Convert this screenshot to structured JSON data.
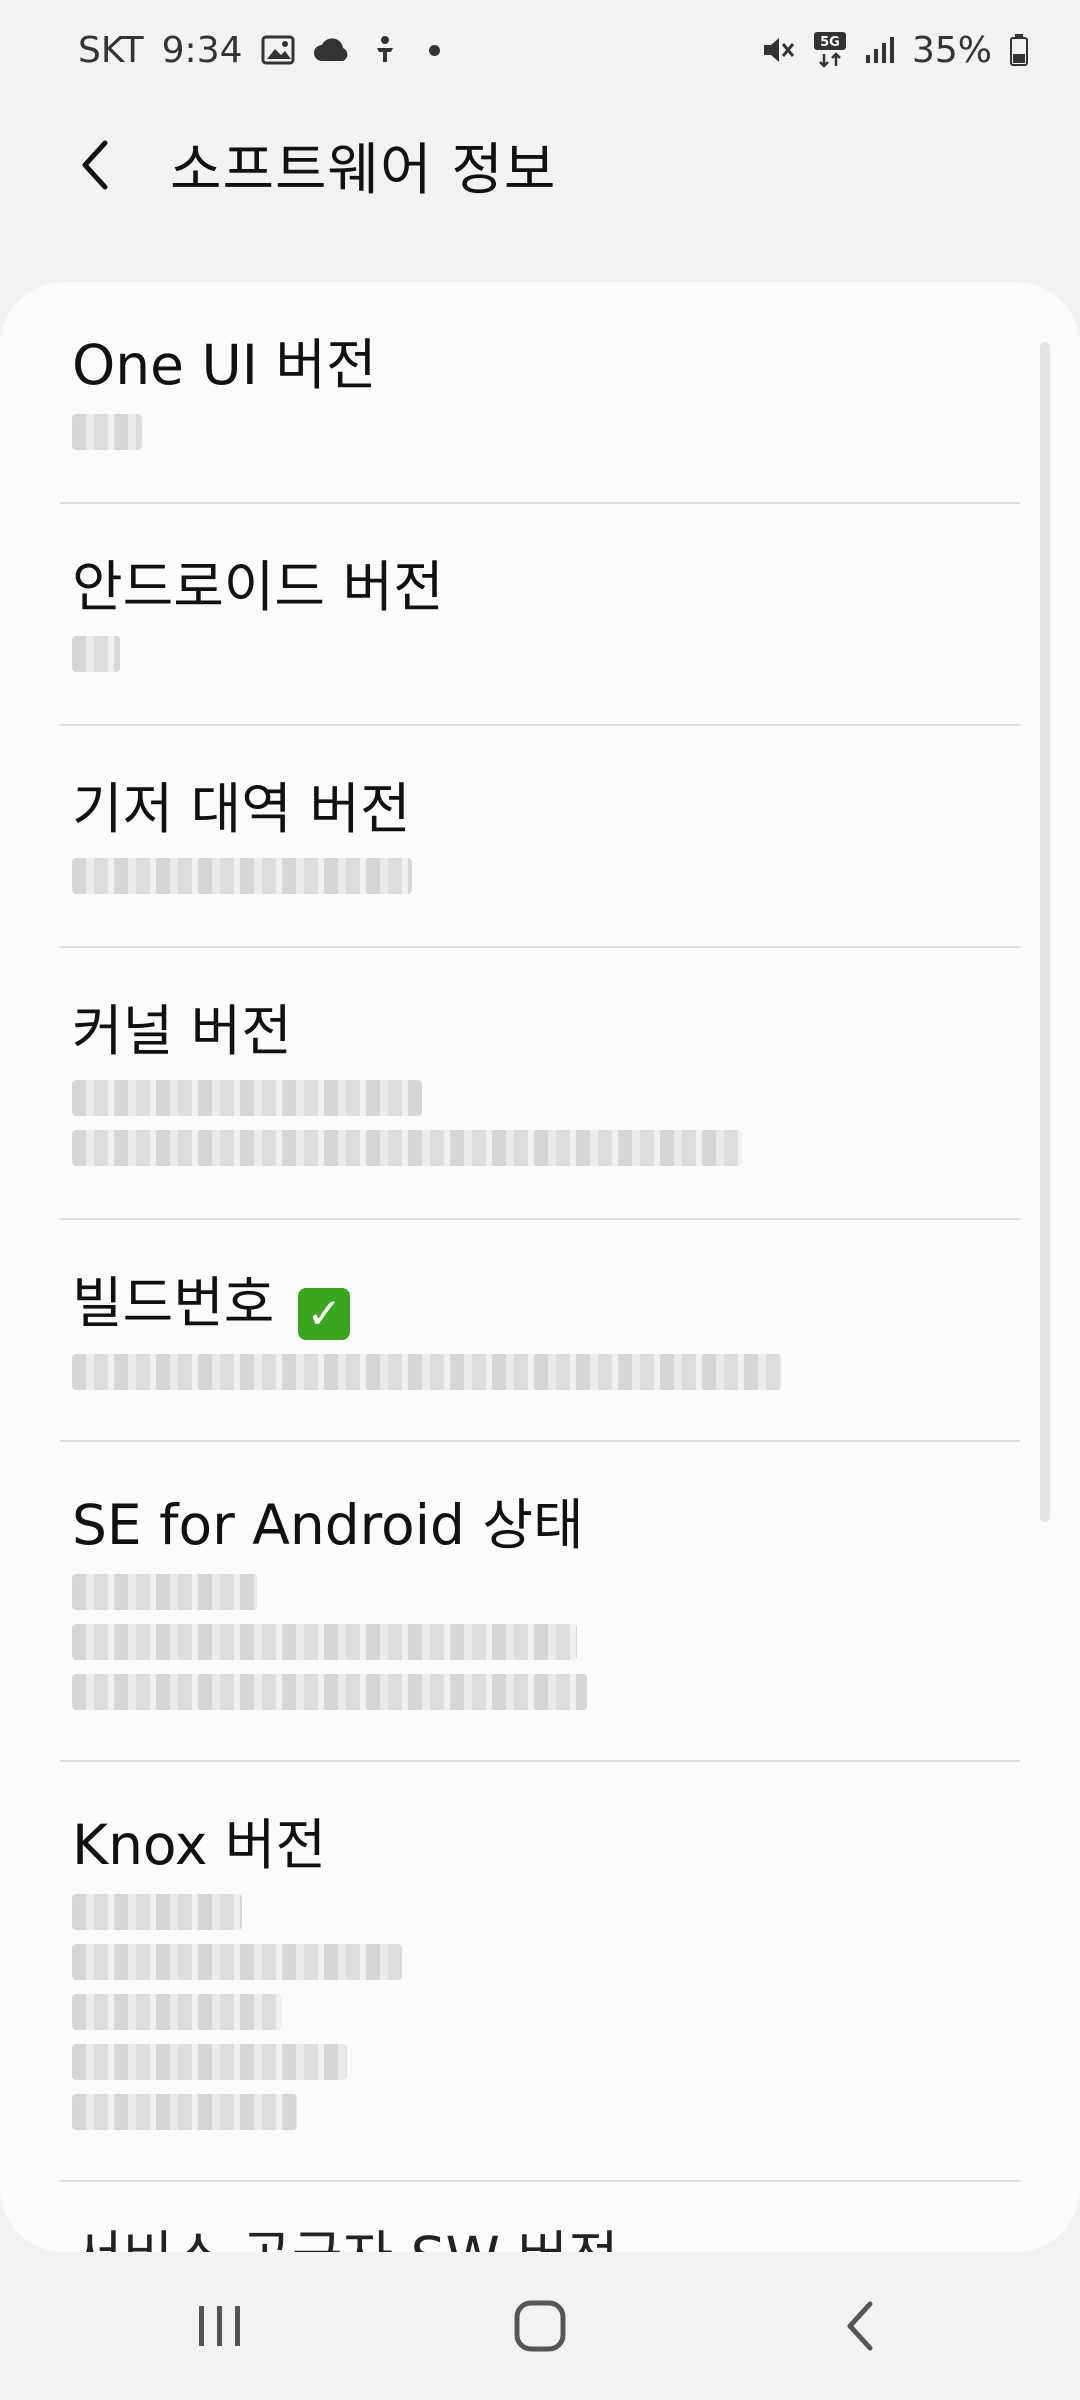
{
  "status_bar": {
    "carrier": "SKT",
    "time": "9:34",
    "network": "5G",
    "battery": "35%"
  },
  "header": {
    "title": "소프트웨어 정보"
  },
  "items": [
    {
      "title": "One UI 버전"
    },
    {
      "title": "안드로이드 버전"
    },
    {
      "title": "기저 대역 버전"
    },
    {
      "title": "커널 버전"
    },
    {
      "title": "빌드번호"
    },
    {
      "title": "SE for Android 상태"
    },
    {
      "title": "Knox 버전"
    },
    {
      "title": "서비스 공급자 SW 버전"
    }
  ],
  "icons": {
    "back": "chevron-left-icon",
    "build_check": "check-mark-icon",
    "nav_recents": "recents-icon",
    "nav_home": "home-icon",
    "nav_back": "back-icon"
  },
  "colors": {
    "background": "#f2f2f2",
    "card": "#fbfbfb",
    "check": "#3aa620"
  }
}
